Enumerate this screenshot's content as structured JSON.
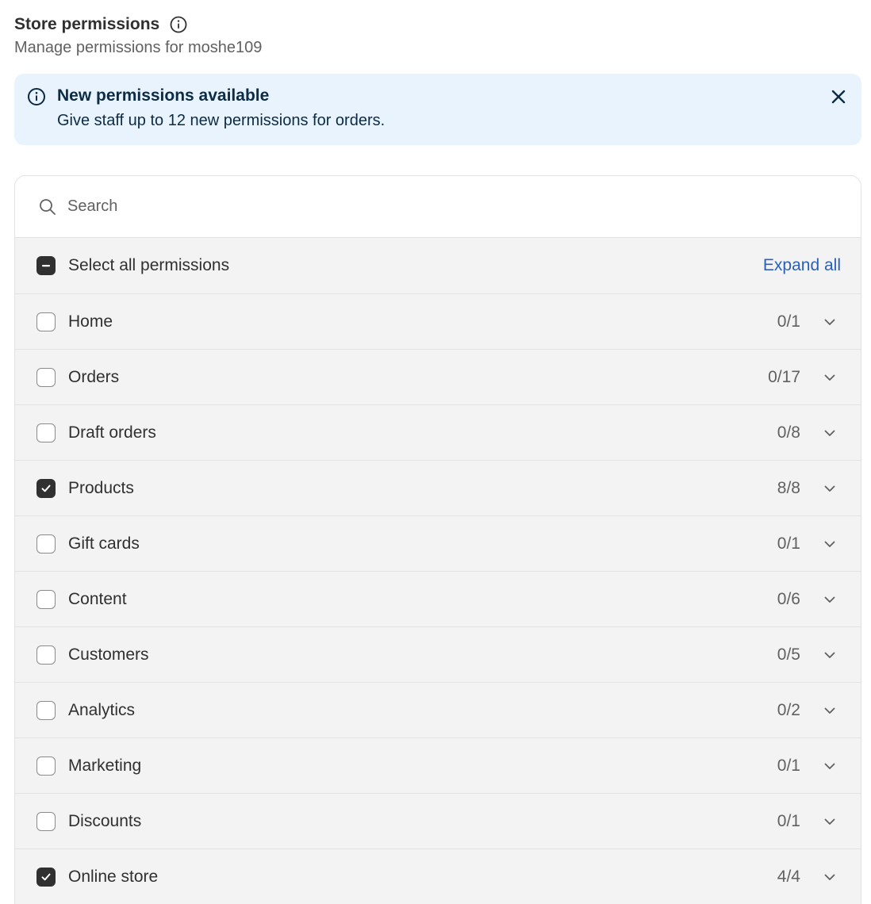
{
  "header": {
    "title": "Store permissions",
    "subtitle": "Manage permissions for moshe109"
  },
  "banner": {
    "title": "New permissions available",
    "text": "Give staff up to 12 new permissions for orders.",
    "icon": "info-icon",
    "close_icon": "close-icon"
  },
  "search": {
    "placeholder": "Search",
    "value": ""
  },
  "select_all": {
    "label": "Select all permissions",
    "state": "indeterminate",
    "expand_label": "Expand all"
  },
  "permissions": [
    {
      "label": "Home",
      "count": "0/1",
      "checked": false
    },
    {
      "label": "Orders",
      "count": "0/17",
      "checked": false
    },
    {
      "label": "Draft orders",
      "count": "0/8",
      "checked": false
    },
    {
      "label": "Products",
      "count": "8/8",
      "checked": true
    },
    {
      "label": "Gift cards",
      "count": "0/1",
      "checked": false
    },
    {
      "label": "Content",
      "count": "0/6",
      "checked": false
    },
    {
      "label": "Customers",
      "count": "0/5",
      "checked": false
    },
    {
      "label": "Analytics",
      "count": "0/2",
      "checked": false
    },
    {
      "label": "Marketing",
      "count": "0/1",
      "checked": false
    },
    {
      "label": "Discounts",
      "count": "0/1",
      "checked": false
    },
    {
      "label": "Online store",
      "count": "4/4",
      "checked": true
    }
  ],
  "colors": {
    "banner_bg": "#e8f3fd",
    "link": "#2c5fb8",
    "checkbox_filled": "#303030"
  }
}
